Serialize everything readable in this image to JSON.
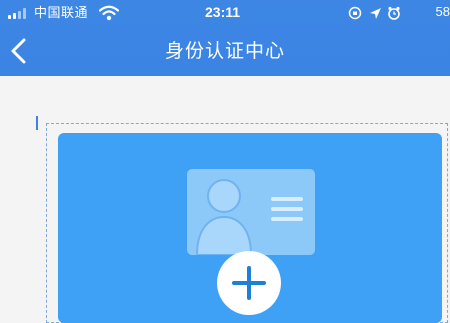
{
  "status_bar": {
    "carrier": "中国联通",
    "time": "23:11",
    "battery": "58",
    "icons": [
      "signal-icon",
      "wifi-icon",
      "rotation-lock-icon",
      "location-icon",
      "alarm-icon"
    ]
  },
  "nav": {
    "title": "身份认证中心",
    "back_icon": "chevron-left-icon"
  },
  "upload": {
    "card_icon": "id-card-icon",
    "add_icon": "plus-icon"
  },
  "colors": {
    "header": "#3b84e3",
    "card": "#3ea1f5",
    "background": "#f4f4f4"
  }
}
